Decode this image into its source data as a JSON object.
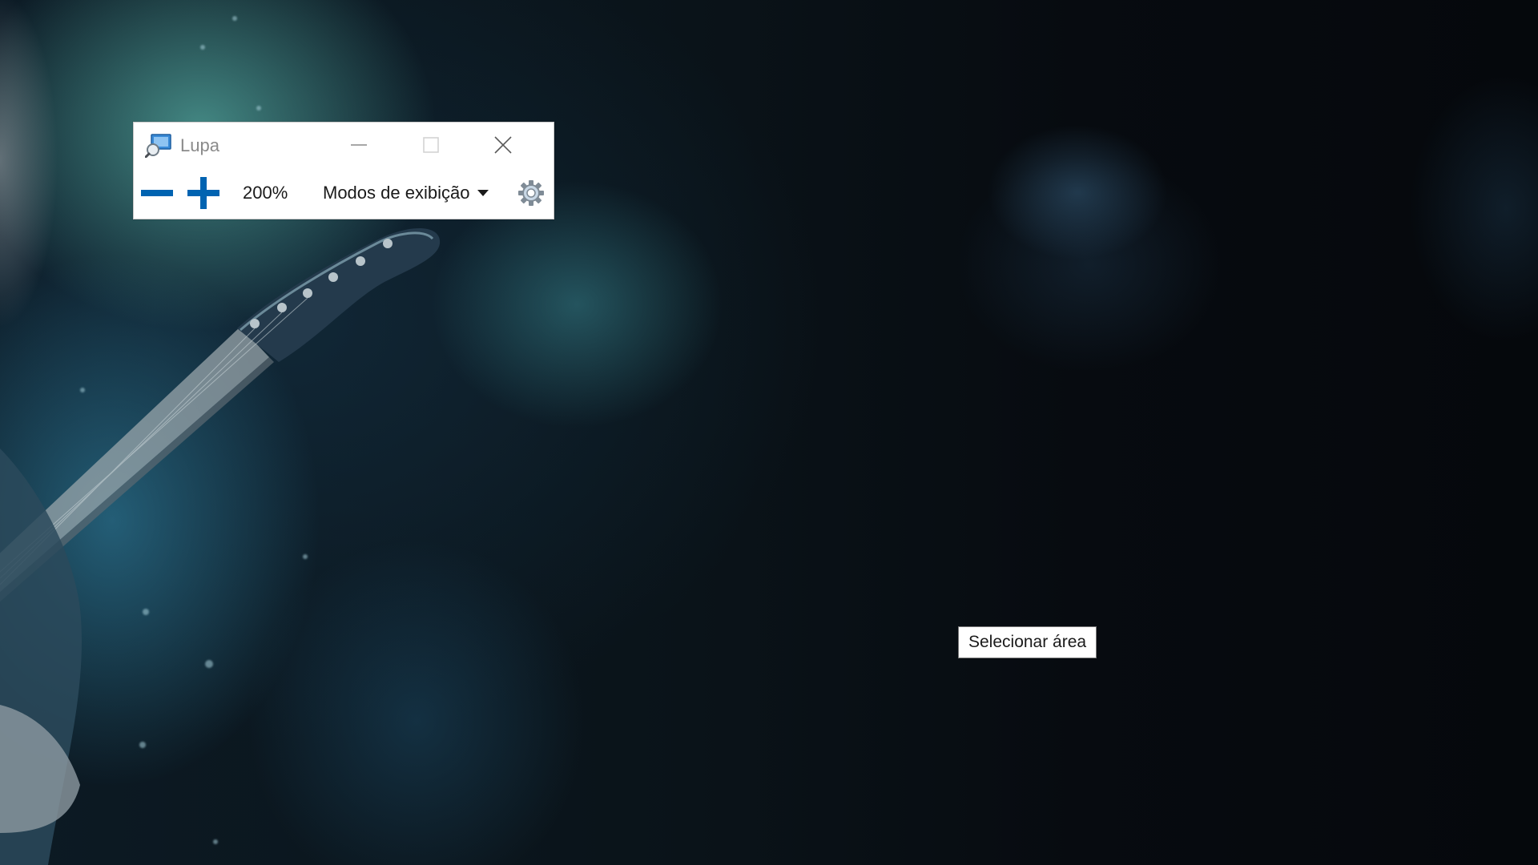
{
  "desktop": {
    "wallpaper": "starry-nebula-guitar-wallpaper"
  },
  "magnifier": {
    "title": "Lupa",
    "app_icon": "magnifier-app-icon",
    "caption_buttons": {
      "minimize_icon": "minimize-icon",
      "maximize_icon": "maximize-icon",
      "close_icon": "close-icon"
    },
    "toolbar": {
      "zoom_out_icon": "minus-icon",
      "zoom_in_icon": "plus-icon",
      "zoom_level": "200%",
      "views_label": "Modos de exibição",
      "views_icon": "caret-down-icon",
      "settings_icon": "gear-icon"
    },
    "colors": {
      "accent": "#0063b1",
      "title_text": "#8a8a8a",
      "text": "#1a1a1a"
    }
  },
  "tooltip": {
    "text": "Selecionar área"
  }
}
